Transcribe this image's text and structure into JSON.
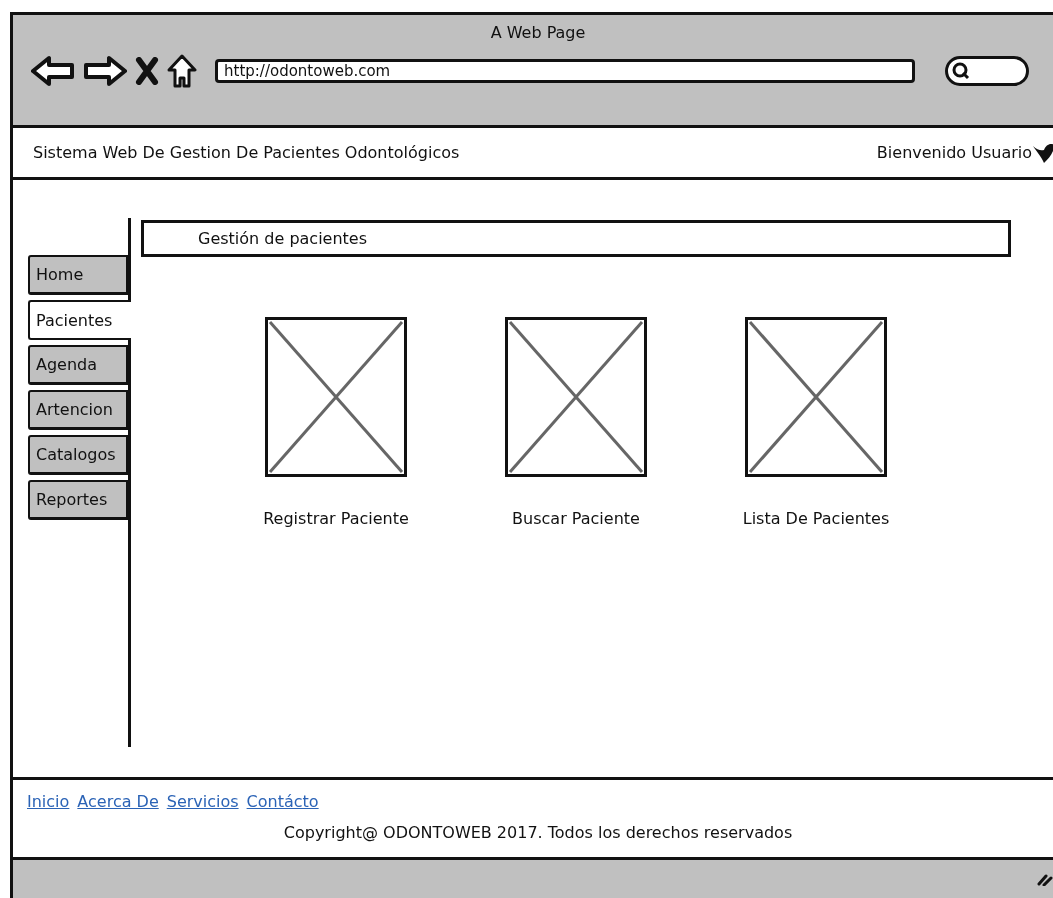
{
  "browser": {
    "title": "A Web Page",
    "url": "http://odontoweb.com"
  },
  "header": {
    "title": "Sistema Web De Gestion De Pacientes Odontológicos",
    "welcome": "Bienvenido Usuario"
  },
  "sidebar": {
    "tabs": [
      {
        "label": "Home",
        "selected": false
      },
      {
        "label": "Pacientes",
        "selected": true
      },
      {
        "label": "Agenda",
        "selected": false
      },
      {
        "label": "Artencion",
        "selected": false
      },
      {
        "label": "Catalogos",
        "selected": false
      },
      {
        "label": "Reportes",
        "selected": false
      }
    ]
  },
  "content": {
    "heading": "Gestión de pacientes",
    "cards": [
      {
        "label": "Registrar Paciente"
      },
      {
        "label": "Buscar Paciente"
      },
      {
        "label": "Lista De Pacientes"
      }
    ]
  },
  "footer": {
    "links": [
      "Inicio",
      "Acerca De",
      "Servicios",
      "Contácto"
    ],
    "copyright": "Copyright@ ODONTOWEB 2017. Todos los derechos reservados"
  }
}
